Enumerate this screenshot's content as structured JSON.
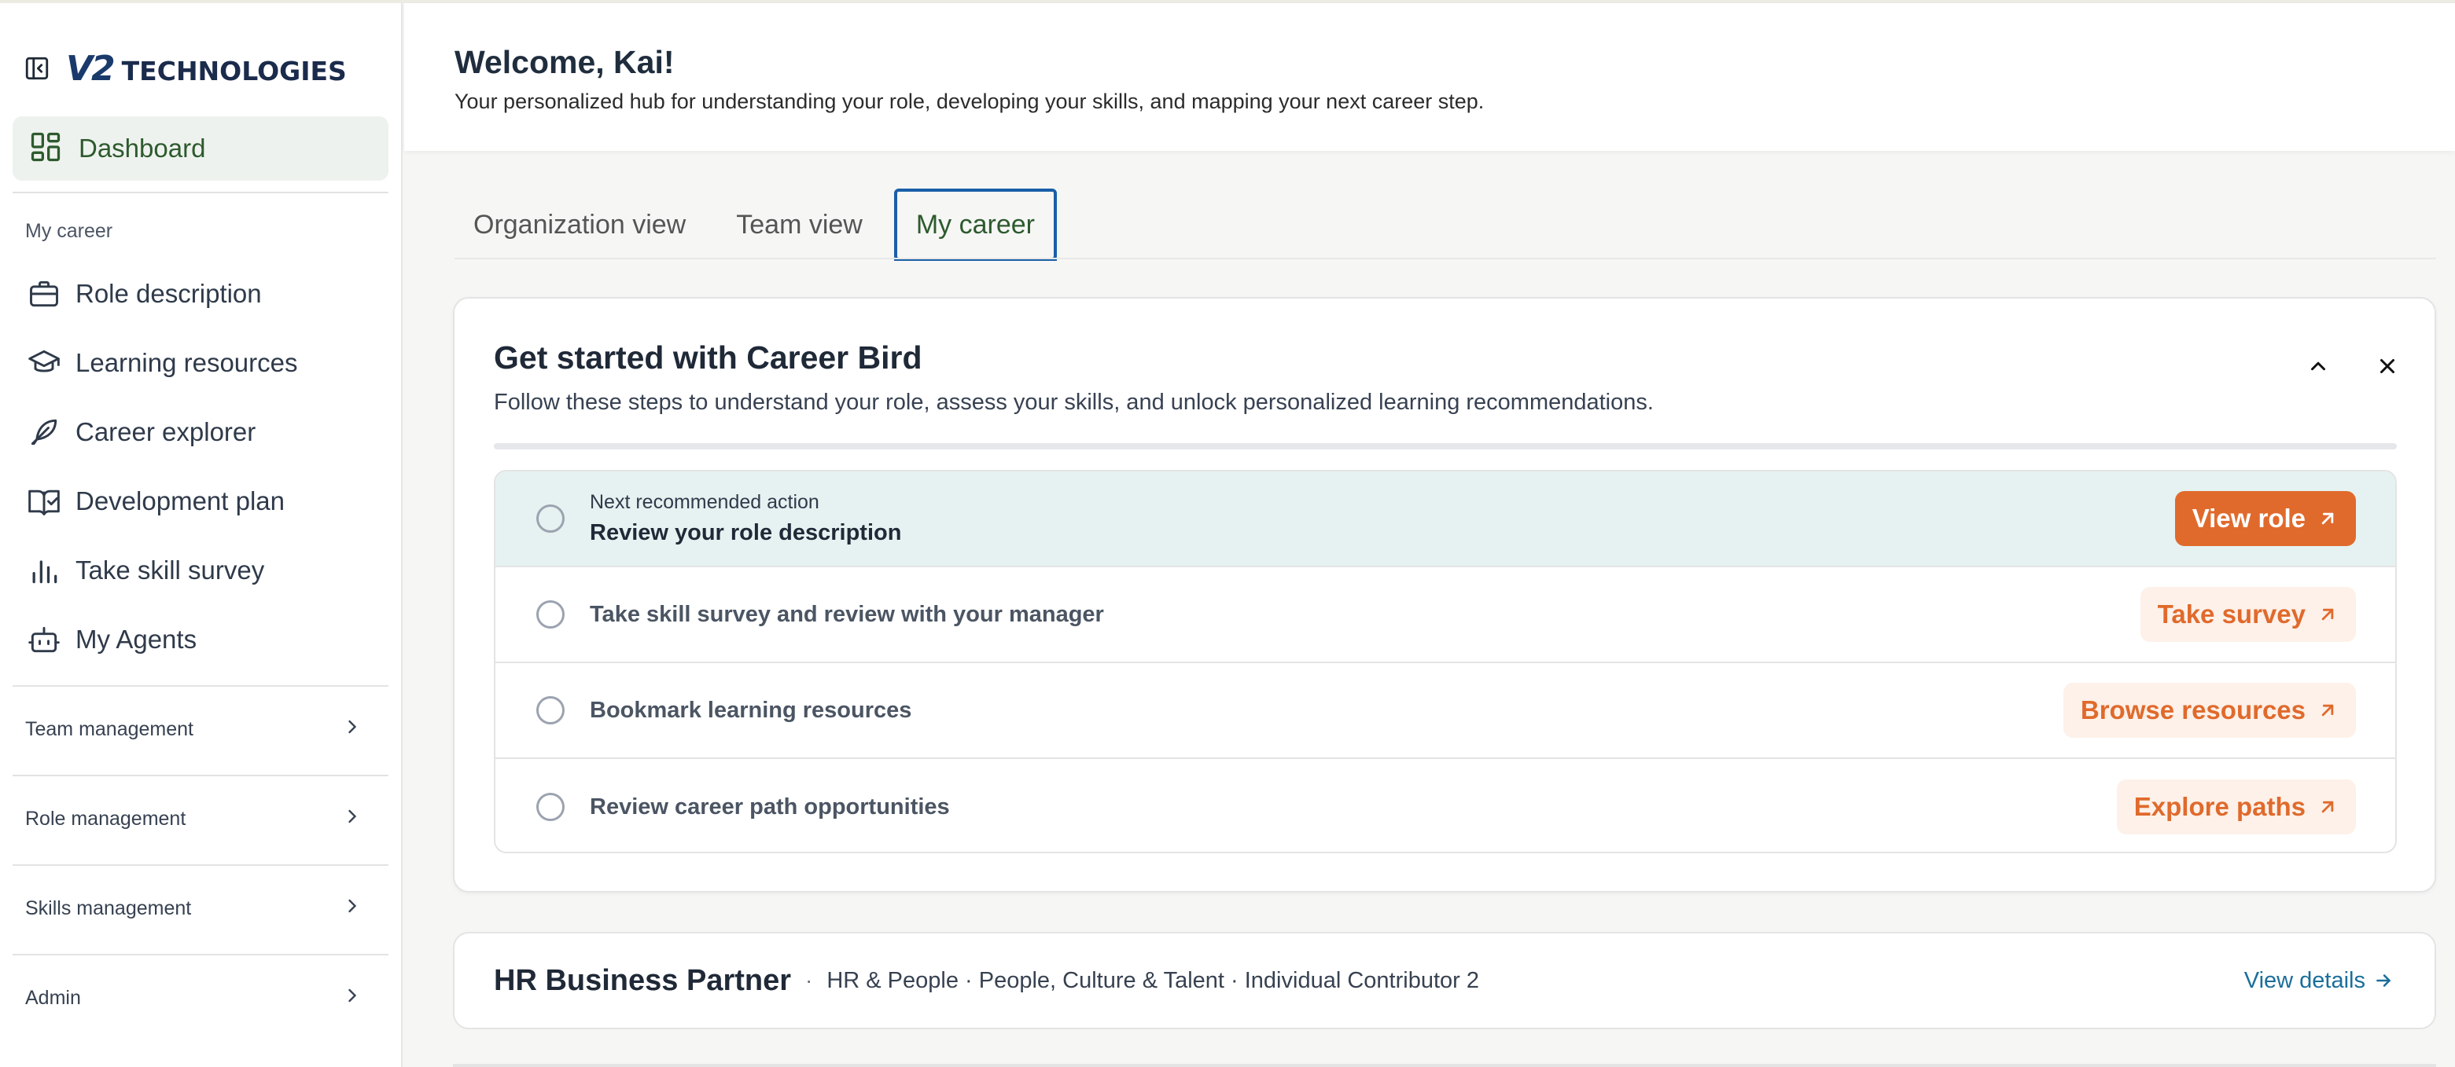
{
  "brand": {
    "logo_mark": "V2",
    "logo_text": "TECHNOLOGIES"
  },
  "sidebar": {
    "dashboard_label": "Dashboard",
    "section_label": "My career",
    "items": [
      {
        "label": "Role description",
        "icon": "briefcase-icon"
      },
      {
        "label": "Learning resources",
        "icon": "graduation-cap-icon"
      },
      {
        "label": "Career explorer",
        "icon": "feather-icon"
      },
      {
        "label": "Development plan",
        "icon": "book-check-icon"
      },
      {
        "label": "Take skill survey",
        "icon": "bar-chart-icon"
      },
      {
        "label": "My Agents",
        "icon": "bot-icon"
      }
    ],
    "groups": [
      {
        "label": "Team management"
      },
      {
        "label": "Role management"
      },
      {
        "label": "Skills management"
      },
      {
        "label": "Admin"
      }
    ]
  },
  "header": {
    "welcome": "Welcome, Kai!",
    "subtitle": "Your personalized hub for understanding your role, developing your skills, and mapping your next career step."
  },
  "tabs": [
    {
      "label": "Organization view",
      "active": false
    },
    {
      "label": "Team view",
      "active": false
    },
    {
      "label": "My career",
      "active": true
    }
  ],
  "getting_started": {
    "title": "Get started with Career Bird",
    "subtitle": "Follow these steps to understand your role, assess your skills, and unlock personalized learning recommendations.",
    "steps": [
      {
        "kicker": "Next recommended action",
        "label": "Review your role description",
        "button": "View role",
        "primary": true
      },
      {
        "kicker": "",
        "label": "Take skill survey and review with your manager",
        "button": "Take survey",
        "primary": false
      },
      {
        "kicker": "",
        "label": "Bookmark learning resources",
        "button": "Browse resources",
        "primary": false
      },
      {
        "kicker": "",
        "label": "Review career path opportunities",
        "button": "Explore paths",
        "primary": false
      }
    ]
  },
  "role_summary": {
    "title": "HR Business Partner",
    "separator": "·",
    "meta": "HR & People · People, Culture & Talent · Individual Contributor 2",
    "link": "View details"
  },
  "colors": {
    "accent_orange": "#e06a2c",
    "accent_green": "#2d5a2d",
    "focus_blue": "#1a5fa8",
    "link_teal": "#1a6e9a",
    "highlight_bg": "#e5f2f1"
  }
}
